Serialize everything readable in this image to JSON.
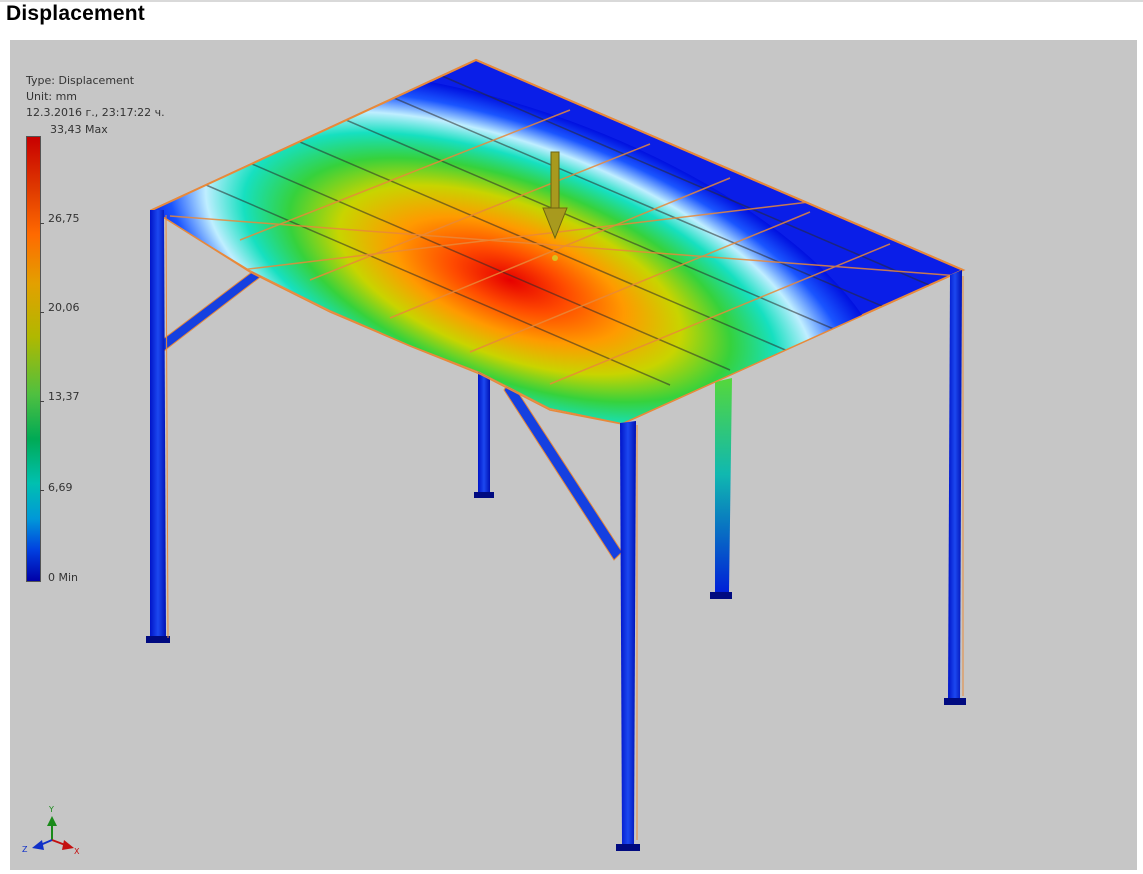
{
  "title": "Displacement",
  "legend": {
    "type_line": "Type: Displacement",
    "unit_line": "Unit: mm",
    "date_line": "12.3.2016 г., 23:17:22 ч.",
    "max_label": "33,43 Max",
    "ticks": [
      "26,75",
      "20,06",
      "13,37",
      "6,69"
    ],
    "min_label": "0 Min"
  },
  "axes_triad": {
    "x": "X",
    "y": "Y",
    "z": "Z"
  },
  "colors": {
    "background": "#c6c6c6",
    "max": "#c80000",
    "min": "#0000a8",
    "frame_outline": "#e8893a",
    "load_arrow": "#a89a1e"
  },
  "icons": [
    "load-arrow-icon",
    "axis-triad-icon"
  ]
}
